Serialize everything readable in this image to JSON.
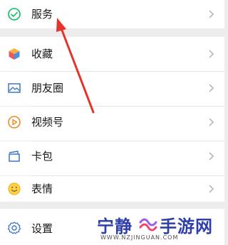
{
  "menu": {
    "items": [
      {
        "label": "服务",
        "icon": "service-check-icon"
      },
      {
        "label": "收藏",
        "icon": "favorites-cube-icon"
      },
      {
        "label": "朋友圈",
        "icon": "moments-image-icon"
      },
      {
        "label": "视频号",
        "icon": "channels-play-icon"
      },
      {
        "label": "卡包",
        "icon": "card-wallet-icon"
      },
      {
        "label": "表情",
        "icon": "sticker-smile-icon"
      },
      {
        "label": "设置",
        "icon": "settings-gear-icon"
      }
    ]
  },
  "watermark": {
    "left_text": "宁静",
    "right_text": "手游网",
    "url": "WWW.NZJINGUAN.COM"
  },
  "colors": {
    "background": "#ededed",
    "row": "#ffffff",
    "text": "#181818",
    "chevron": "#b2b2b2",
    "arrow": "#e5352b",
    "service_icon": "#07c160",
    "watermark_text": "#2f3fa9"
  }
}
